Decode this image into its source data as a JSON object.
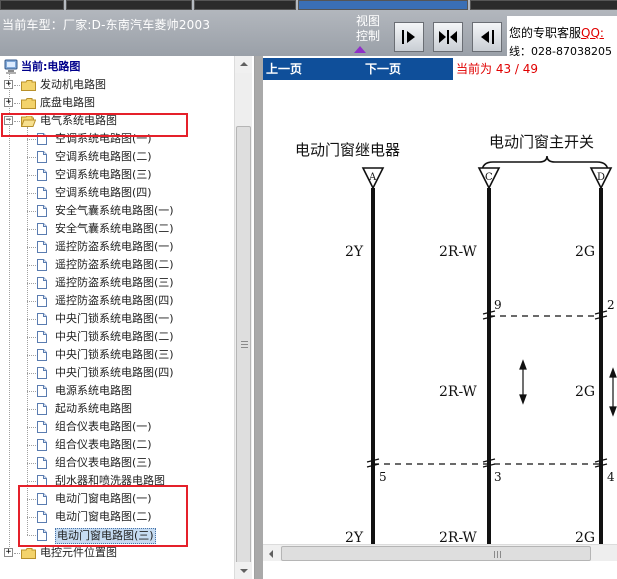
{
  "header": {
    "car_info": "当前车型：厂家:D-东南汽车菱帅2003",
    "view_control_label_1": "视图",
    "view_control_label_2": "控制",
    "service_line_1": "您的专职客服",
    "service_qq": "QQ:",
    "service_line_2": "线：028-87038205"
  },
  "toolbar": {
    "buttons": [
      {
        "name": "forward-page-icon"
      },
      {
        "name": "fit-page-icon"
      },
      {
        "name": "back-page-icon"
      }
    ]
  },
  "tree": {
    "root_label": "当前:电路图",
    "items": [
      {
        "label": "发动机电路图",
        "type": "folder",
        "expanded": false
      },
      {
        "label": "底盘电路图",
        "type": "folder",
        "expanded": false
      },
      {
        "label": "电气系统电路图",
        "type": "folder",
        "expanded": true
      },
      {
        "label": "空调系统电路图(一)",
        "type": "doc"
      },
      {
        "label": "空调系统电路图(二)",
        "type": "doc"
      },
      {
        "label": "空调系统电路图(三)",
        "type": "doc"
      },
      {
        "label": "空调系统电路图(四)",
        "type": "doc"
      },
      {
        "label": "安全气囊系统电路图(一)",
        "type": "doc"
      },
      {
        "label": "安全气囊系统电路图(二)",
        "type": "doc"
      },
      {
        "label": "遥控防盗系统电路图(一)",
        "type": "doc"
      },
      {
        "label": "遥控防盗系统电路图(二)",
        "type": "doc"
      },
      {
        "label": "遥控防盗系统电路图(三)",
        "type": "doc"
      },
      {
        "label": "遥控防盗系统电路图(四)",
        "type": "doc"
      },
      {
        "label": "中央门锁系统电路图(一)",
        "type": "doc"
      },
      {
        "label": "中央门锁系统电路图(二)",
        "type": "doc"
      },
      {
        "label": "中央门锁系统电路图(三)",
        "type": "doc"
      },
      {
        "label": "中央门锁系统电路图(四)",
        "type": "doc"
      },
      {
        "label": "电源系统电路图",
        "type": "doc"
      },
      {
        "label": "起动系统电路图",
        "type": "doc"
      },
      {
        "label": "组合仪表电路图(一)",
        "type": "doc"
      },
      {
        "label": "组合仪表电路图(二)",
        "type": "doc"
      },
      {
        "label": "组合仪表电路图(三)",
        "type": "doc"
      },
      {
        "label": "刮水器和喷洗器电路图",
        "type": "doc"
      },
      {
        "label": "电动门窗电路图(一)",
        "type": "doc"
      },
      {
        "label": "电动门窗电路图(二)",
        "type": "doc"
      },
      {
        "label": "电动门窗电路图(三)",
        "type": "doc",
        "selected": true
      },
      {
        "label": "电控元件位置图",
        "type": "folder",
        "expanded": false
      }
    ]
  },
  "viewer": {
    "prev_label": "上一页",
    "next_label": "下一页",
    "page_indicator": "当前为 43 / 49"
  },
  "diagram": {
    "relay_title": "电动门窗继电器",
    "switch_title": "电动门窗主开关",
    "connectors": [
      "A",
      "C",
      "D"
    ],
    "wire_labels": [
      "2Y",
      "2R-W",
      "2G",
      "2R-W",
      "2G",
      "2Y",
      "2R-W",
      "2G"
    ],
    "pin_labels": [
      "9",
      "2",
      "5",
      "3",
      "4"
    ]
  },
  "colors": {
    "nav_blue": "#0f4f9a",
    "page_indicator_red": "#e00000",
    "highlight_red": "#e5202a",
    "selection_bg": "#c6dcf2"
  }
}
